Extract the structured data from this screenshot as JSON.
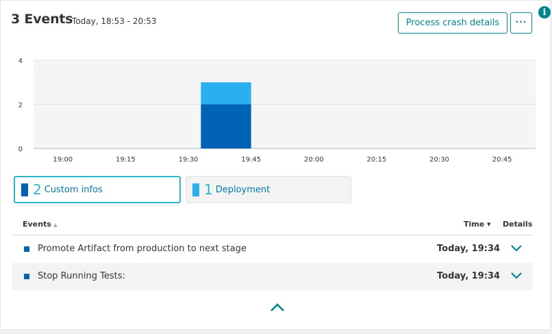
{
  "header": {
    "title": "3 Events",
    "range": "Today, 18:53 - 20:53",
    "process_crash_label": "Process crash details",
    "more_label": "···",
    "info_label": "i"
  },
  "chart_data": {
    "type": "bar",
    "stacked": true,
    "yticks": [
      "0",
      "2",
      "4"
    ],
    "ylim": [
      0,
      4
    ],
    "xticks": [
      "19:00",
      "19:15",
      "19:30",
      "19:45",
      "20:00",
      "20:15",
      "20:30",
      "20:45"
    ],
    "xrange": [
      "18:53",
      "20:53"
    ],
    "bar_interval": [
      "19:33",
      "19:45"
    ],
    "series": [
      {
        "name": "Custom infos",
        "color": "#0063b4",
        "values": [
          2
        ]
      },
      {
        "name": "Deployment",
        "color": "#2ab0f0",
        "values": [
          1
        ]
      }
    ],
    "grid": true
  },
  "legend": [
    {
      "count": "2",
      "label": "Custom infos",
      "color": "#0063b4",
      "selected": true
    },
    {
      "count": "1",
      "label": "Deployment",
      "color": "#2ab0f0",
      "selected": false
    }
  ],
  "table": {
    "headers": {
      "events": "Events",
      "time": "Time ▾",
      "details": "Details"
    },
    "rows": [
      {
        "text": "Promote Artifact from production to next stage",
        "time": "Today, 19:34"
      },
      {
        "text": "Stop Running Tests:",
        "time": "Today, 19:34"
      }
    ]
  },
  "colors": {
    "accent": "#00848e",
    "highlight": "#2ab6c5",
    "custom": "#0063b4",
    "deployment": "#2ab0f0"
  }
}
